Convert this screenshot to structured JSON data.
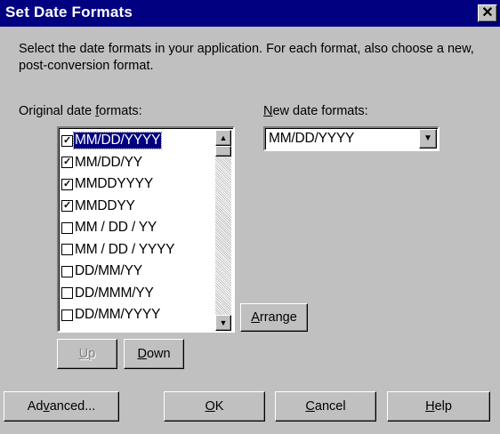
{
  "window": {
    "title": "Set Date Formats",
    "close_glyph": "✕"
  },
  "intro": {
    "text": "Select the date formats in your application. For each format, also choose a new, post-conversion format."
  },
  "original_formats": {
    "label_pre": "Original date ",
    "label_accel": "f",
    "label_post": "ormats:",
    "items": [
      {
        "label": "MM/DD/YYYY",
        "checked": true,
        "selected": true
      },
      {
        "label": "MM/DD/YY",
        "checked": true,
        "selected": false
      },
      {
        "label": "MMDDYYYY",
        "checked": true,
        "selected": false
      },
      {
        "label": "MMDDYY",
        "checked": true,
        "selected": false
      },
      {
        "label": "MM / DD / YY",
        "checked": false,
        "selected": false
      },
      {
        "label": "MM / DD / YYYY",
        "checked": false,
        "selected": false
      },
      {
        "label": "DD/MM/YY",
        "checked": false,
        "selected": false
      },
      {
        "label": "DD/MMM/YY",
        "checked": false,
        "selected": false
      },
      {
        "label": "DD/MM/YYYY",
        "checked": false,
        "selected": false
      }
    ],
    "scroll_up_icon": "▲",
    "scroll_down_icon": "▼"
  },
  "new_formats": {
    "label_accel": "N",
    "label_post": "ew date formats:",
    "selected_value": "MM/DD/YYYY",
    "dropdown_icon": "▼"
  },
  "buttons": {
    "arrange": {
      "accel": "A",
      "rest": "rrange"
    },
    "up": {
      "accel": "U",
      "rest": "p",
      "disabled": true
    },
    "down": {
      "accel": "D",
      "rest": "own"
    },
    "advanced": {
      "pre": "Ad",
      "accel": "v",
      "rest": "anced..."
    },
    "ok": {
      "accel": "O",
      "rest": "K"
    },
    "cancel": {
      "accel": "C",
      "rest": "ancel"
    },
    "help": {
      "accel": "H",
      "rest": "elp"
    }
  },
  "colors": {
    "titlebar": "#000080",
    "face": "#c0c0c0",
    "selection": "#000080"
  }
}
